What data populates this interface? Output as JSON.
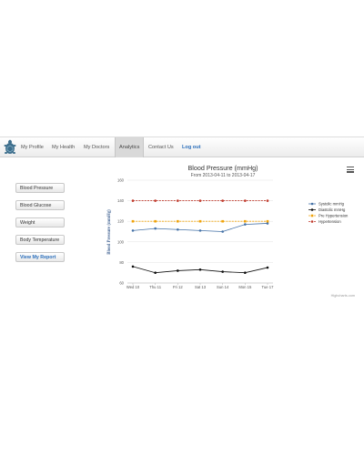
{
  "nav": {
    "items": [
      {
        "label": "My Profile"
      },
      {
        "label": "My Health"
      },
      {
        "label": "My Doctors"
      },
      {
        "label": "Analytics"
      },
      {
        "label": "Contact Us"
      }
    ],
    "logout": "Log out",
    "logo_icon": "turtle-logo-icon"
  },
  "sidebar": {
    "buttons": [
      {
        "label": "Blood Pressure"
      },
      {
        "label": "Blood Glucose"
      },
      {
        "label": "Weight"
      },
      {
        "label": "Body Temperature"
      }
    ],
    "report_label": "View My Report"
  },
  "chart_data": {
    "type": "line",
    "title": "Blood Pressure (mmHg)",
    "subtitle": "From 2013-04-11 to 2013-04-17",
    "ylabel": "Blood Pressure (mmHg)",
    "xlabel": "",
    "categories": [
      "Wed 10",
      "Thu 11",
      "Fri 12",
      "Sat 13",
      "Sun 14",
      "Mon 15",
      "Tue 17"
    ],
    "ylim": [
      60,
      160
    ],
    "yticks": [
      60,
      80,
      100,
      120,
      140,
      160
    ],
    "grid": true,
    "legend_position": "right",
    "series": [
      {
        "name": "Systolic mmHg",
        "color": "#4572a7",
        "marker": "circle",
        "dash": false,
        "values": [
          111,
          113,
          112,
          111,
          110,
          117,
          118
        ]
      },
      {
        "name": "Diastolic mmHg",
        "color": "#111111",
        "marker": "circle",
        "dash": false,
        "values": [
          76,
          70,
          72,
          73,
          71,
          70,
          75
        ]
      },
      {
        "name": "Pre Hypertension",
        "color": "#f0a30a",
        "marker": "square",
        "dash": true,
        "values": [
          120,
          120,
          120,
          120,
          120,
          120,
          120
        ]
      },
      {
        "name": "Hypertension",
        "color": "#c0392b",
        "marker": "circle",
        "dash": true,
        "values": [
          140,
          140,
          140,
          140,
          140,
          140,
          140
        ]
      }
    ],
    "credits": "Highcharts.com"
  }
}
